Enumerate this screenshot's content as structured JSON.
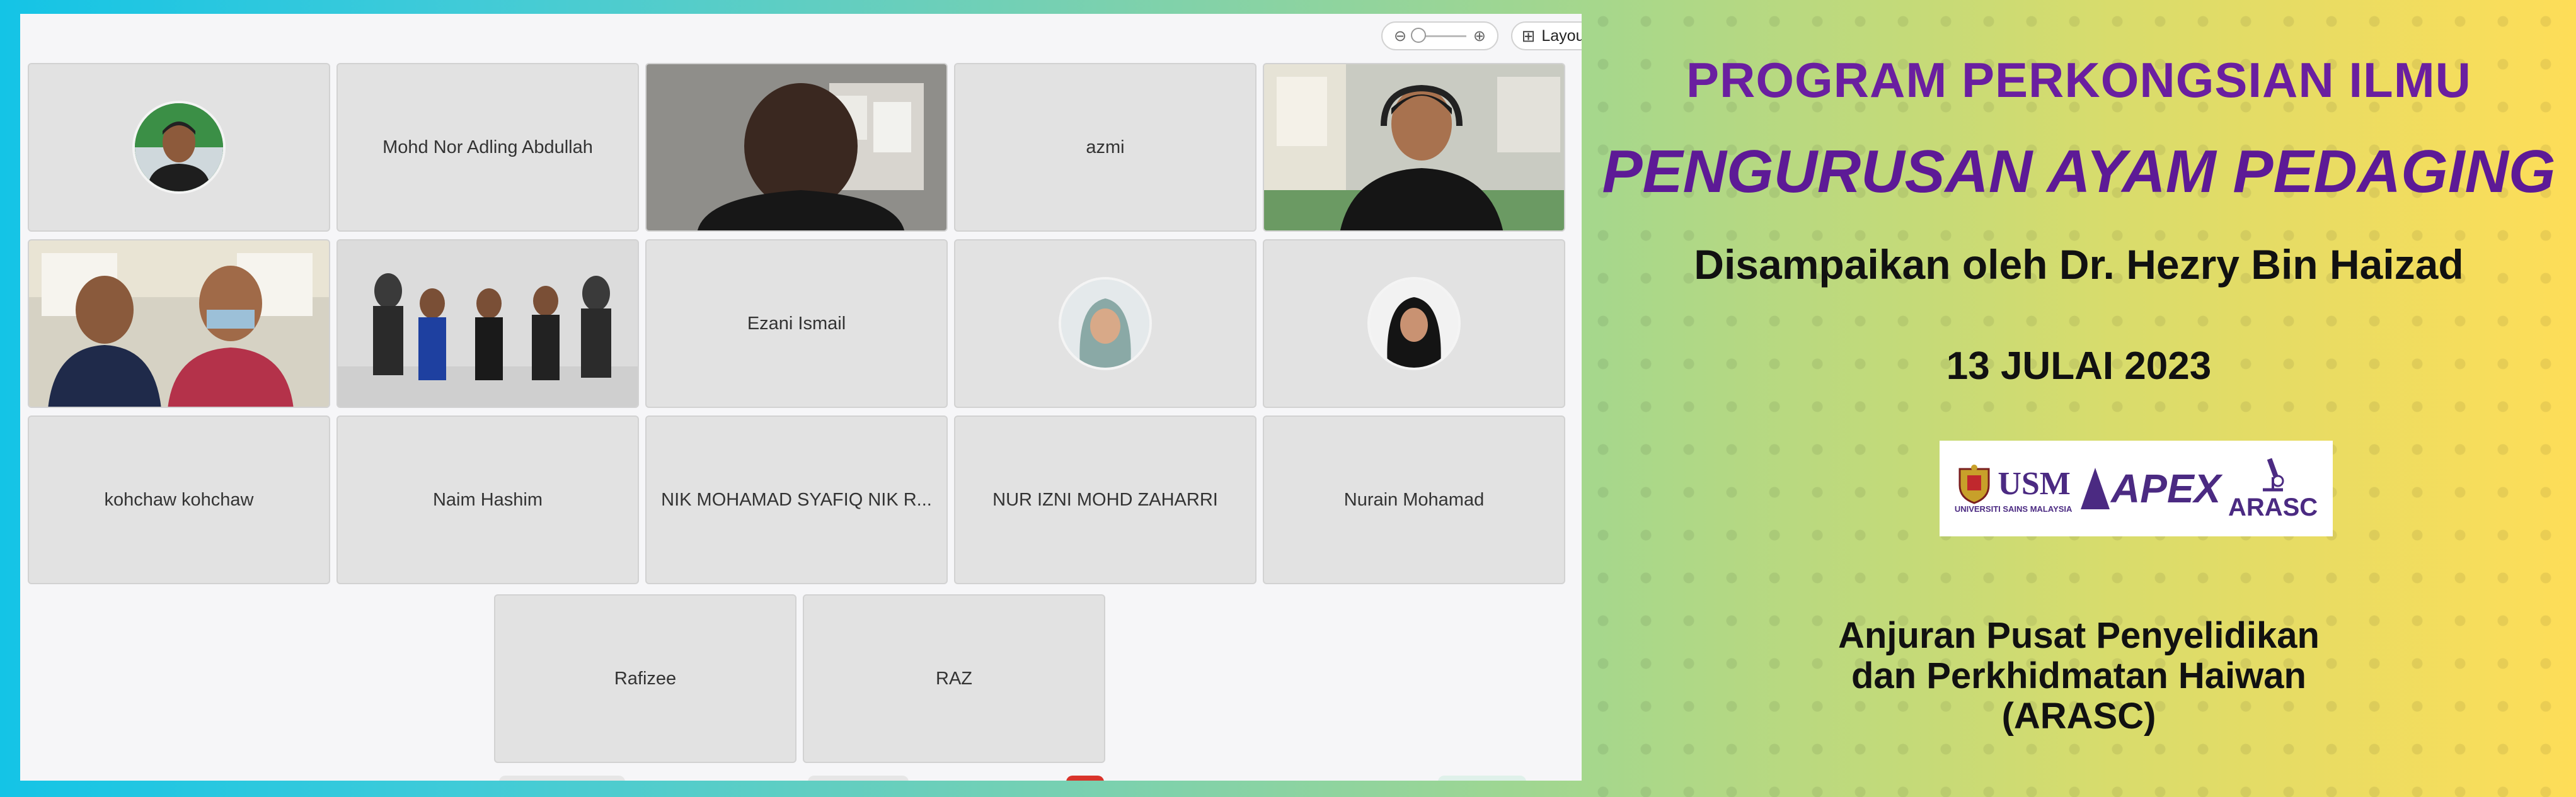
{
  "meeting": {
    "layout_label": "Layout",
    "participants": [
      {
        "name": "",
        "kind": "avatar"
      },
      {
        "name": "Mohd Nor Adling Abdullah",
        "kind": "name"
      },
      {
        "name": "",
        "kind": "video"
      },
      {
        "name": "azmi",
        "kind": "name"
      },
      {
        "name": "",
        "kind": "video"
      },
      {
        "name": "",
        "kind": "video"
      },
      {
        "name": "",
        "kind": "video"
      },
      {
        "name": "Ezani Ismail",
        "kind": "name"
      },
      {
        "name": "",
        "kind": "avatar"
      },
      {
        "name": "",
        "kind": "avatar"
      },
      {
        "name": "kohchaw kohchaw",
        "kind": "name"
      },
      {
        "name": "Naim Hashim",
        "kind": "name"
      },
      {
        "name": "NIK MOHAMAD SYAFIQ NIK R...",
        "kind": "name"
      },
      {
        "name": "NUR IZNI MOHD ZAHARRI",
        "kind": "name"
      },
      {
        "name": "Nurain Mohamad",
        "kind": "name"
      },
      {
        "name": "Rafizee",
        "kind": "name"
      },
      {
        "name": "RAZ",
        "kind": "name"
      }
    ]
  },
  "banner": {
    "program": "PROGRAM PERKONGSIAN ILMU",
    "topic": "PENGURUSAN AYAM PEDAGING",
    "presenter": "Disampaikan oleh Dr. Hezry Bin Haizad",
    "date": "13 JULAI 2023",
    "logos": {
      "usm": "USM",
      "usm_sub": "UNIVERSITI SAINS MALAYSIA",
      "apex": "APEX",
      "arasc": "ARASC"
    },
    "organizer_line1": "Anjuran Pusat Penyelidikan",
    "organizer_line2": "dan Perkhidmatan Haiwan",
    "organizer_line3": "(ARASC)"
  },
  "colors": {
    "title_purple": "#6a1fa0",
    "tile_bg": "#e2e2e2"
  }
}
